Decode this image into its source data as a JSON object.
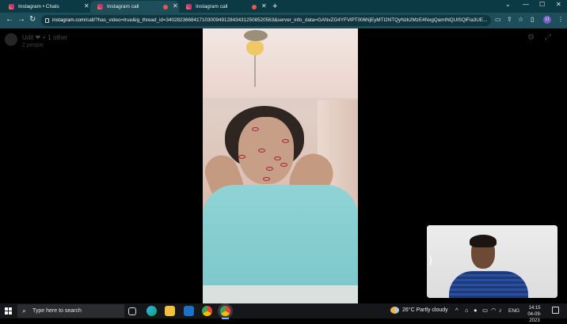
{
  "tabs": [
    {
      "title": "Instagram • Chats",
      "active": false
    },
    {
      "title": "Instagram call",
      "active": true
    },
    {
      "title": "Instagram call",
      "active": false
    }
  ],
  "browser": {
    "url_domain": "instagram.com",
    "url_rest": "/call/?has_video=true&ig_thread_id=340282366841710300949128434312508520563&server_info_data=GANvZG4YFVlPT006NjEyMTI2NTQyNzk2MzE4NxgQamtNQUlSQlFia3UE...",
    "profile_initial": "U",
    "icons": [
      "back-icon",
      "forward-icon",
      "reload-icon",
      "cast-icon",
      "zoom-icon",
      "share-icon",
      "star-icon",
      "sidebar-icon",
      "menu-icon"
    ]
  },
  "call": {
    "title": "Udit ❤ + 1 other",
    "subtitle": "2 people"
  },
  "taskbar": {
    "search_placeholder": "Type here to search",
    "weather_temp": "26°C",
    "weather_desc": "Partly cloudy",
    "language": "ENG",
    "time": "14:15",
    "date": "04-09-2023"
  },
  "colors": {
    "tabstrip": "#0c3a44",
    "toolbar": "#1d4e59",
    "taskbar": "#16171a"
  }
}
